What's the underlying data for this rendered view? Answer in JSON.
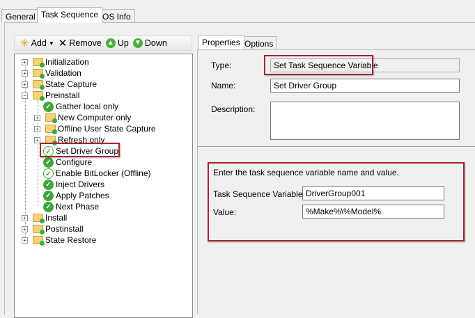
{
  "tabs": [
    "General",
    "Task Sequence",
    "OS Info"
  ],
  "toolbar": {
    "add": "Add",
    "remove": "Remove",
    "up": "Up",
    "down": "Down"
  },
  "tree": [
    {
      "label": "Initialization",
      "level": 0,
      "type": "folder",
      "expander": "+"
    },
    {
      "label": "Validation",
      "level": 0,
      "type": "folder",
      "expander": "+"
    },
    {
      "label": "State Capture",
      "level": 0,
      "type": "folder",
      "expander": "+"
    },
    {
      "label": "Preinstall",
      "level": 0,
      "type": "folder",
      "expander": "-"
    },
    {
      "label": "Gather local only",
      "level": 1,
      "type": "step"
    },
    {
      "label": "New Computer only",
      "level": 1,
      "type": "folder",
      "expander": "+"
    },
    {
      "label": "Offline User State Capture",
      "level": 1,
      "type": "folder",
      "expander": "+"
    },
    {
      "label": "Refresh only",
      "level": 1,
      "type": "folder",
      "expander": "+"
    },
    {
      "label": "Set Driver Group",
      "level": 1,
      "type": "step-light",
      "selected": true
    },
    {
      "label": "Configure",
      "level": 1,
      "type": "step"
    },
    {
      "label": "Enable BitLocker (Offline)",
      "level": 1,
      "type": "step-light"
    },
    {
      "label": "Inject Drivers",
      "level": 1,
      "type": "step"
    },
    {
      "label": "Apply Patches",
      "level": 1,
      "type": "step"
    },
    {
      "label": "Next Phase",
      "level": 1,
      "type": "step"
    },
    {
      "label": "Install",
      "level": 0,
      "type": "folder",
      "expander": "+"
    },
    {
      "label": "Postinstall",
      "level": 0,
      "type": "folder",
      "expander": "+"
    },
    {
      "label": "State Restore",
      "level": 0,
      "type": "folder",
      "expander": "+"
    }
  ],
  "props": {
    "tabs": [
      "Properties",
      "Options"
    ],
    "type_label": "Type:",
    "type_value": "Set Task Sequence Variable",
    "name_label": "Name:",
    "name_value": "Set Driver Group",
    "desc_label": "Description:",
    "desc_value": "",
    "instructions": "Enter the task sequence variable name and value.",
    "var_label": "Task Sequence Variable:",
    "var_value": "DriverGroup001",
    "value_label": "Value:",
    "value_value": "%Make%\\%Model%"
  }
}
